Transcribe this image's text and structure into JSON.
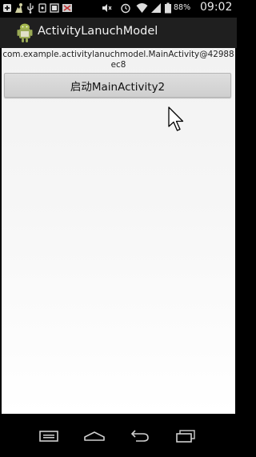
{
  "status_bar": {
    "icons": [
      "add-icon",
      "android-debug-icon",
      "usb-icon",
      "notification-icon",
      "image-icon",
      "no-sim-icon",
      "mute-icon",
      "alarm-icon",
      "wifi-icon",
      "signal-icon"
    ],
    "battery_percent": "88%",
    "time": "09:02"
  },
  "action_bar": {
    "title": "ActivityLanuchModel",
    "icon": "android-app-icon"
  },
  "main": {
    "activity_text": "com.example.activitylanuchmodel.MainActivity@42988ec8",
    "launch_button_label": "启动MainActivity2"
  },
  "nav_bar": {
    "icons": [
      "menu-icon",
      "home-icon",
      "back-icon",
      "recent-apps-icon"
    ]
  },
  "colors": {
    "action_bar_bg": "#1f1f1f",
    "button_bg": "#d6d6d6",
    "content_bg": "#f4f4f4"
  }
}
